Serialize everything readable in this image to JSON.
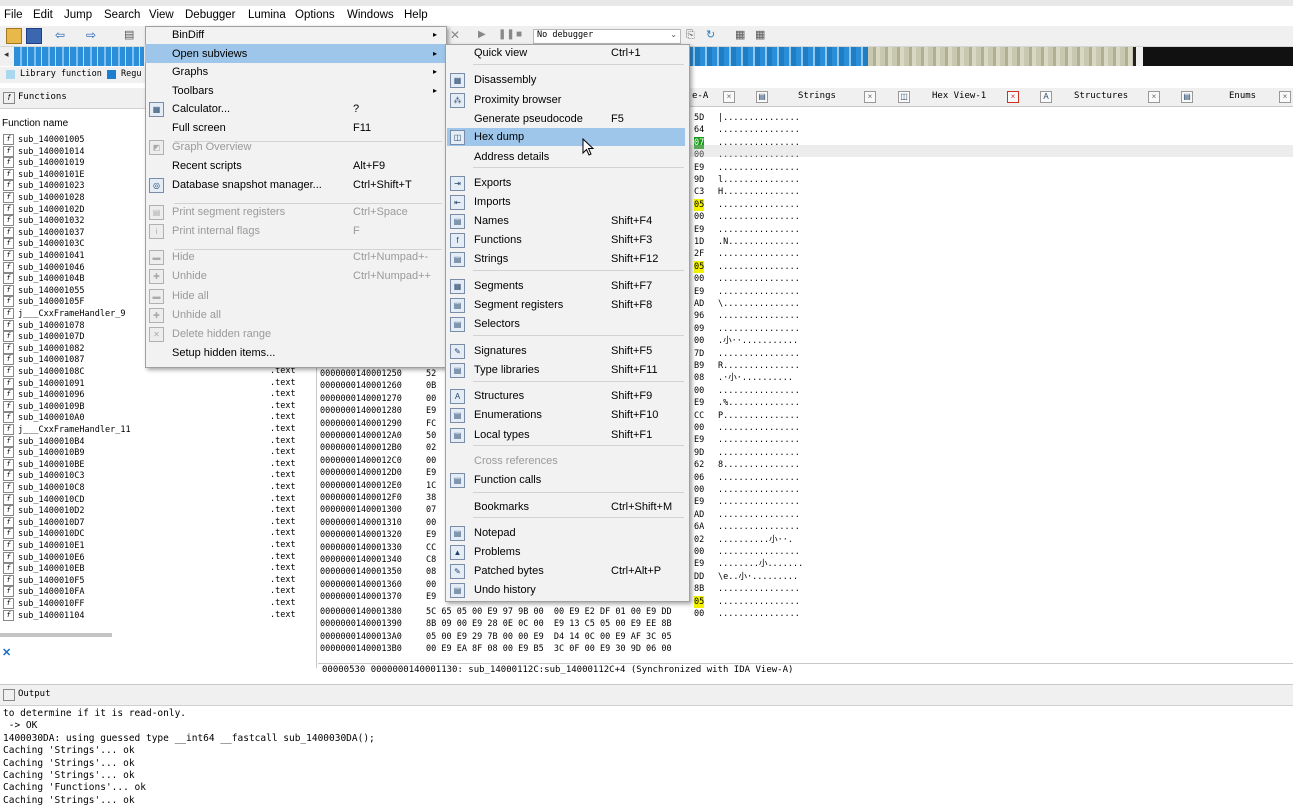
{
  "menubar": [
    "File",
    "Edit",
    "Jump",
    "Search",
    "View",
    "Debugger",
    "Lumina",
    "Options",
    "Windows",
    "Help"
  ],
  "toolbar": {
    "debugger_select": "No debugger"
  },
  "legend": {
    "library_function": "Library function",
    "regular": "Regu"
  },
  "functions_pane": {
    "title": "Functions",
    "column_header": "Function name",
    "rows": [
      {
        "name": "sub_140001005",
        "seg": ""
      },
      {
        "name": "sub_140001014",
        "seg": ""
      },
      {
        "name": "sub_140001019",
        "seg": ""
      },
      {
        "name": "sub_14000101E",
        "seg": ""
      },
      {
        "name": "sub_140001023",
        "seg": ""
      },
      {
        "name": "sub_140001028",
        "seg": ""
      },
      {
        "name": "sub_14000102D",
        "seg": ""
      },
      {
        "name": "sub_140001032",
        "seg": ""
      },
      {
        "name": "sub_140001037",
        "seg": ""
      },
      {
        "name": "sub_14000103C",
        "seg": ""
      },
      {
        "name": "sub_140001041",
        "seg": ""
      },
      {
        "name": "sub_140001046",
        "seg": ""
      },
      {
        "name": "sub_14000104B",
        "seg": ""
      },
      {
        "name": "sub_140001055",
        "seg": ""
      },
      {
        "name": "sub_14000105F",
        "seg": ""
      },
      {
        "name": "j___CxxFrameHandler_9",
        "seg": ""
      },
      {
        "name": "sub_140001078",
        "seg": ""
      },
      {
        "name": "sub_14000107D",
        "seg": ""
      },
      {
        "name": "sub_140001082",
        "seg": ""
      },
      {
        "name": "sub_140001087",
        "seg": ""
      },
      {
        "name": "sub_14000108C",
        "seg": ".text"
      },
      {
        "name": "sub_140001091",
        "seg": ".text"
      },
      {
        "name": "sub_140001096",
        "seg": ".text"
      },
      {
        "name": "sub_14000109B",
        "seg": ".text"
      },
      {
        "name": "sub_1400010A0",
        "seg": ".text"
      },
      {
        "name": "j___CxxFrameHandler_11",
        "seg": ".text"
      },
      {
        "name": "sub_1400010B4",
        "seg": ".text"
      },
      {
        "name": "sub_1400010B9",
        "seg": ".text"
      },
      {
        "name": "sub_1400010BE",
        "seg": ".text"
      },
      {
        "name": "sub_1400010C3",
        "seg": ".text"
      },
      {
        "name": "sub_1400010C8",
        "seg": ".text"
      },
      {
        "name": "sub_1400010CD",
        "seg": ".text"
      },
      {
        "name": "sub_1400010D2",
        "seg": ".text"
      },
      {
        "name": "sub_1400010D7",
        "seg": ".text"
      },
      {
        "name": "sub_1400010DC",
        "seg": ".text"
      },
      {
        "name": "sub_1400010E1",
        "seg": ".text"
      },
      {
        "name": "sub_1400010E6",
        "seg": ".text"
      },
      {
        "name": "sub_1400010EB",
        "seg": ".text"
      },
      {
        "name": "sub_1400010F5",
        "seg": ".text"
      },
      {
        "name": "sub_1400010FA",
        "seg": ".text"
      },
      {
        "name": "sub_1400010FF",
        "seg": ".text"
      },
      {
        "name": "sub_140001104",
        "seg": ".text"
      }
    ]
  },
  "view_menu": {
    "items": [
      {
        "label": "BinDiff",
        "shortcut": "",
        "disabled": false,
        "submenu": true
      },
      {
        "label": "Open subviews",
        "shortcut": "",
        "disabled": false,
        "submenu": true
      },
      {
        "label": "Graphs",
        "shortcut": "",
        "disabled": false,
        "submenu": true
      },
      {
        "label": "Toolbars",
        "shortcut": "",
        "disabled": false,
        "submenu": true
      },
      {
        "label": "Calculator...",
        "shortcut": "?",
        "disabled": false
      },
      {
        "label": "Full screen",
        "shortcut": "F11",
        "disabled": false
      },
      {
        "label": "Graph Overview",
        "shortcut": "",
        "disabled": true
      },
      {
        "label": "Recent scripts",
        "shortcut": "Alt+F9",
        "disabled": false
      },
      {
        "label": "Database snapshot manager...",
        "shortcut": "Ctrl+Shift+T",
        "disabled": false
      },
      {
        "label": "Print segment registers",
        "shortcut": "Ctrl+Space",
        "disabled": true
      },
      {
        "label": "Print internal flags",
        "shortcut": "F",
        "disabled": true
      },
      {
        "label": "Hide",
        "shortcut": "Ctrl+Numpad+-",
        "disabled": true
      },
      {
        "label": "Unhide",
        "shortcut": "Ctrl+Numpad++",
        "disabled": true
      },
      {
        "label": "Hide all",
        "shortcut": "",
        "disabled": true
      },
      {
        "label": "Unhide all",
        "shortcut": "",
        "disabled": true
      },
      {
        "label": "Delete hidden range",
        "shortcut": "",
        "disabled": true
      },
      {
        "label": "Setup hidden items...",
        "shortcut": "",
        "disabled": false
      }
    ]
  },
  "subviews_menu": {
    "items": [
      {
        "label": "Quick view",
        "shortcut": "Ctrl+1",
        "disabled": false
      },
      {
        "label": "Disassembly",
        "shortcut": "",
        "disabled": false
      },
      {
        "label": "Proximity browser",
        "shortcut": "",
        "disabled": false
      },
      {
        "label": "Generate pseudocode",
        "shortcut": "F5",
        "disabled": false
      },
      {
        "label": "Hex dump",
        "shortcut": "",
        "disabled": false,
        "selected": true
      },
      {
        "label": "Address details",
        "shortcut": "",
        "disabled": false
      },
      {
        "label": "Exports",
        "shortcut": "",
        "disabled": false
      },
      {
        "label": "Imports",
        "shortcut": "",
        "disabled": false
      },
      {
        "label": "Names",
        "shortcut": "Shift+F4",
        "disabled": false
      },
      {
        "label": "Functions",
        "shortcut": "Shift+F3",
        "disabled": false
      },
      {
        "label": "Strings",
        "shortcut": "Shift+F12",
        "disabled": false
      },
      {
        "label": "Segments",
        "shortcut": "Shift+F7",
        "disabled": false
      },
      {
        "label": "Segment registers",
        "shortcut": "Shift+F8",
        "disabled": false
      },
      {
        "label": "Selectors",
        "shortcut": "",
        "disabled": false
      },
      {
        "label": "Signatures",
        "shortcut": "Shift+F5",
        "disabled": false
      },
      {
        "label": "Type libraries",
        "shortcut": "Shift+F11",
        "disabled": false
      },
      {
        "label": "Structures",
        "shortcut": "Shift+F9",
        "disabled": false
      },
      {
        "label": "Enumerations",
        "shortcut": "Shift+F10",
        "disabled": false
      },
      {
        "label": "Local types",
        "shortcut": "Shift+F1",
        "disabled": false
      },
      {
        "label": "Cross references",
        "shortcut": "",
        "disabled": true
      },
      {
        "label": "Function calls",
        "shortcut": "",
        "disabled": false
      },
      {
        "label": "Bookmarks",
        "shortcut": "Ctrl+Shift+M",
        "disabled": false
      },
      {
        "label": "Notepad",
        "shortcut": "",
        "disabled": false
      },
      {
        "label": "Problems",
        "shortcut": "",
        "disabled": false
      },
      {
        "label": "Patched bytes",
        "shortcut": "Ctrl+Alt+P",
        "disabled": false
      },
      {
        "label": "Undo history",
        "shortcut": "",
        "disabled": false
      }
    ]
  },
  "tabs": [
    {
      "label": "e-A"
    },
    {
      "label": "Strings"
    },
    {
      "label": "Hex View-1"
    },
    {
      "label": "Structures"
    },
    {
      "label": "Enums"
    }
  ],
  "hex_right": {
    "bytes": [
      "5D",
      "64",
      "07",
      "00",
      "E9",
      "9D",
      "C3",
      "05",
      "00",
      "E9",
      "1D",
      "2F",
      "05",
      "00",
      "E9",
      "AD",
      "96",
      "09",
      "00",
      "7D",
      "B9",
      "08",
      "00",
      "E9",
      "CC",
      "00",
      "E9",
      "9D",
      "62",
      "06",
      "00",
      "E9",
      "AD",
      "6A",
      "02",
      "00",
      "E9",
      "DD",
      "8B",
      "05",
      "00"
    ],
    "ascii": [
      "|...............",
      "................",
      "................",
      "................",
      "................",
      "l...............",
      "H...............",
      "................",
      "................",
      "................",
      ".N..............",
      "................",
      "................",
      "................",
      "................",
      "\\...............",
      "................",
      "................",
      ".小··...........",
      "................",
      "R...............",
      ".·小·..........",
      "................",
      ".%..............",
      "P...............",
      "................",
      "................",
      "................",
      "8...............",
      "................",
      "................",
      "................",
      "................",
      "................",
      "..........小··.",
      "................",
      "........小.......",
      "\\e..小·.........",
      "................",
      "................",
      "................",
      "................"
    ]
  },
  "hex_rows": [
    {
      "addr": "0000000140001250",
      "b": "52"
    },
    {
      "addr": "0000000140001260",
      "b": "0B"
    },
    {
      "addr": "0000000140001270",
      "b": "00"
    },
    {
      "addr": "0000000140001280",
      "b": "E9"
    },
    {
      "addr": "0000000140001290",
      "b": "FC"
    },
    {
      "addr": "00000001400012A0",
      "b": "50"
    },
    {
      "addr": "00000001400012B0",
      "b": "02"
    },
    {
      "addr": "00000001400012C0",
      "b": "00"
    },
    {
      "addr": "00000001400012D0",
      "b": "E9"
    },
    {
      "addr": "00000001400012E0",
      "b": "1C"
    },
    {
      "addr": "00000001400012F0",
      "b": "38"
    },
    {
      "addr": "0000000140001300",
      "b": "07"
    },
    {
      "addr": "0000000140001310",
      "b": "00"
    },
    {
      "addr": "0000000140001320",
      "b": "E9"
    },
    {
      "addr": "0000000140001330",
      "b": "CC"
    },
    {
      "addr": "0000000140001340",
      "b": "C8"
    },
    {
      "addr": "0000000140001350",
      "b": "08"
    },
    {
      "addr": "0000000140001360",
      "b": "00"
    },
    {
      "addr": "0000000140001370",
      "b": "E9"
    }
  ],
  "hex_full_rows": [
    {
      "addr": "0000000140001380",
      "bytes": "5C 65 05 00 E9 97 9B 00  00 E9 E2 DF 01 00 E9 DD"
    },
    {
      "addr": "0000000140001390",
      "bytes": "8B 09 00 E9 28 0E 0C 00  E9 13 C5 05 00 E9 EE 8B"
    },
    {
      "addr": "00000001400013A0",
      "bytes": "05 00 E9 29 7B 00 00 E9  D4 14 0C 00 E9 AF 3C 05"
    },
    {
      "addr": "00000001400013B0",
      "bytes": "00 E9 EA 8F 08 00 E9 B5  3C 0F 00 E9 30 9D 06 00"
    }
  ],
  "hex_status": "00000530 0000000140001130: sub_14000112C:sub_14000112C+4 (Synchronized with IDA View-A)",
  "output": {
    "title": "Output",
    "lines": [
      "to determine if it is read-only.",
      " -> OK",
      "1400030DA: using guessed type __int64 __fastcall sub_1400030DA();",
      "Caching 'Strings'... ok",
      "Caching 'Strings'... ok",
      "Caching 'Strings'... ok",
      "Caching 'Functions'... ok",
      "Caching 'Strings'... ok"
    ]
  },
  "colors": {
    "selection": "#9ec6ea",
    "highlight": "#f3f300",
    "nav_blue": "#2a8fd8",
    "menu_bg": "#f2f2f2"
  }
}
